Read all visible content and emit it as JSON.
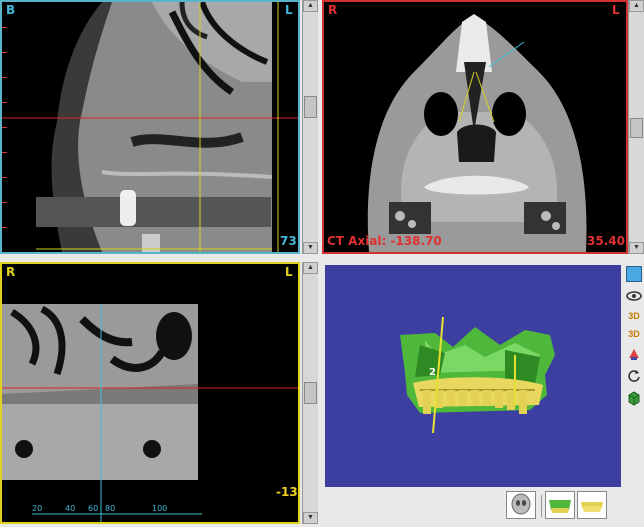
{
  "views": {
    "sagittal": {
      "left_label": "B",
      "right_label": "L",
      "slice_value": "73"
    },
    "axial": {
      "left_label": "R",
      "right_label": "L",
      "caption": "CT Axial: -138.70",
      "value": "35.40"
    },
    "coronal": {
      "left_label": "R",
      "right_label": "L",
      "slice_value": "-13",
      "ruler_ticks": [
        "20",
        "40",
        "60",
        "80",
        "100"
      ]
    }
  },
  "model3d": {
    "background": "#3d3fa0",
    "implant_number": "2",
    "tools": [
      "display-icon",
      "eye-icon",
      "3d-view-icon",
      "3d-rotate-icon",
      "paint-icon",
      "refresh-icon",
      "cube-icon"
    ]
  },
  "colors": {
    "sagittal_border": "#5ab4c8",
    "axial_border": "#d33232",
    "coronal_border": "#e0d21e",
    "crosshair_red": "#e02020",
    "crosshair_yellow": "#d8d020",
    "crosshair_cyan": "#40c0d0",
    "label_cyan": "#42b8d8",
    "value_yellow": "#f0d020"
  }
}
